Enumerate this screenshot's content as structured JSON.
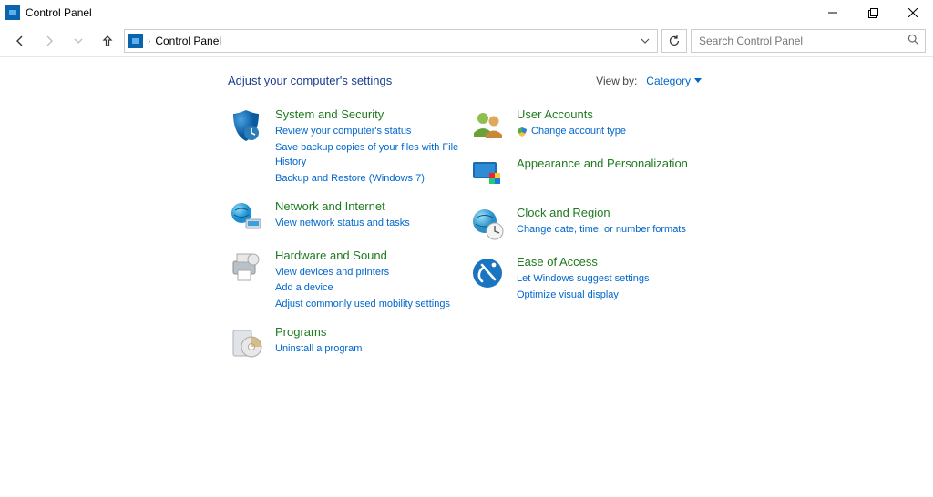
{
  "window": {
    "title": "Control Panel"
  },
  "nav": {
    "breadcrumb": "Control Panel",
    "search_placeholder": "Search Control Panel"
  },
  "header": {
    "title": "Adjust your computer's settings",
    "view_by_label": "View by:",
    "view_by_value": "Category"
  },
  "cats": {
    "system": {
      "title": "System and Security",
      "links": [
        "Review your computer's status",
        "Save backup copies of your files with File History",
        "Backup and Restore (Windows 7)"
      ]
    },
    "network": {
      "title": "Network and Internet",
      "links": [
        "View network status and tasks"
      ]
    },
    "hardware": {
      "title": "Hardware and Sound",
      "links": [
        "View devices and printers",
        "Add a device",
        "Adjust commonly used mobility settings"
      ]
    },
    "programs": {
      "title": "Programs",
      "links": [
        "Uninstall a program"
      ]
    },
    "users": {
      "title": "User Accounts",
      "links": [
        "Change account type"
      ]
    },
    "appearance": {
      "title": "Appearance and Personalization"
    },
    "clock": {
      "title": "Clock and Region",
      "links": [
        "Change date, time, or number formats"
      ]
    },
    "ease": {
      "title": "Ease of Access",
      "links": [
        "Let Windows suggest settings",
        "Optimize visual display"
      ]
    }
  }
}
